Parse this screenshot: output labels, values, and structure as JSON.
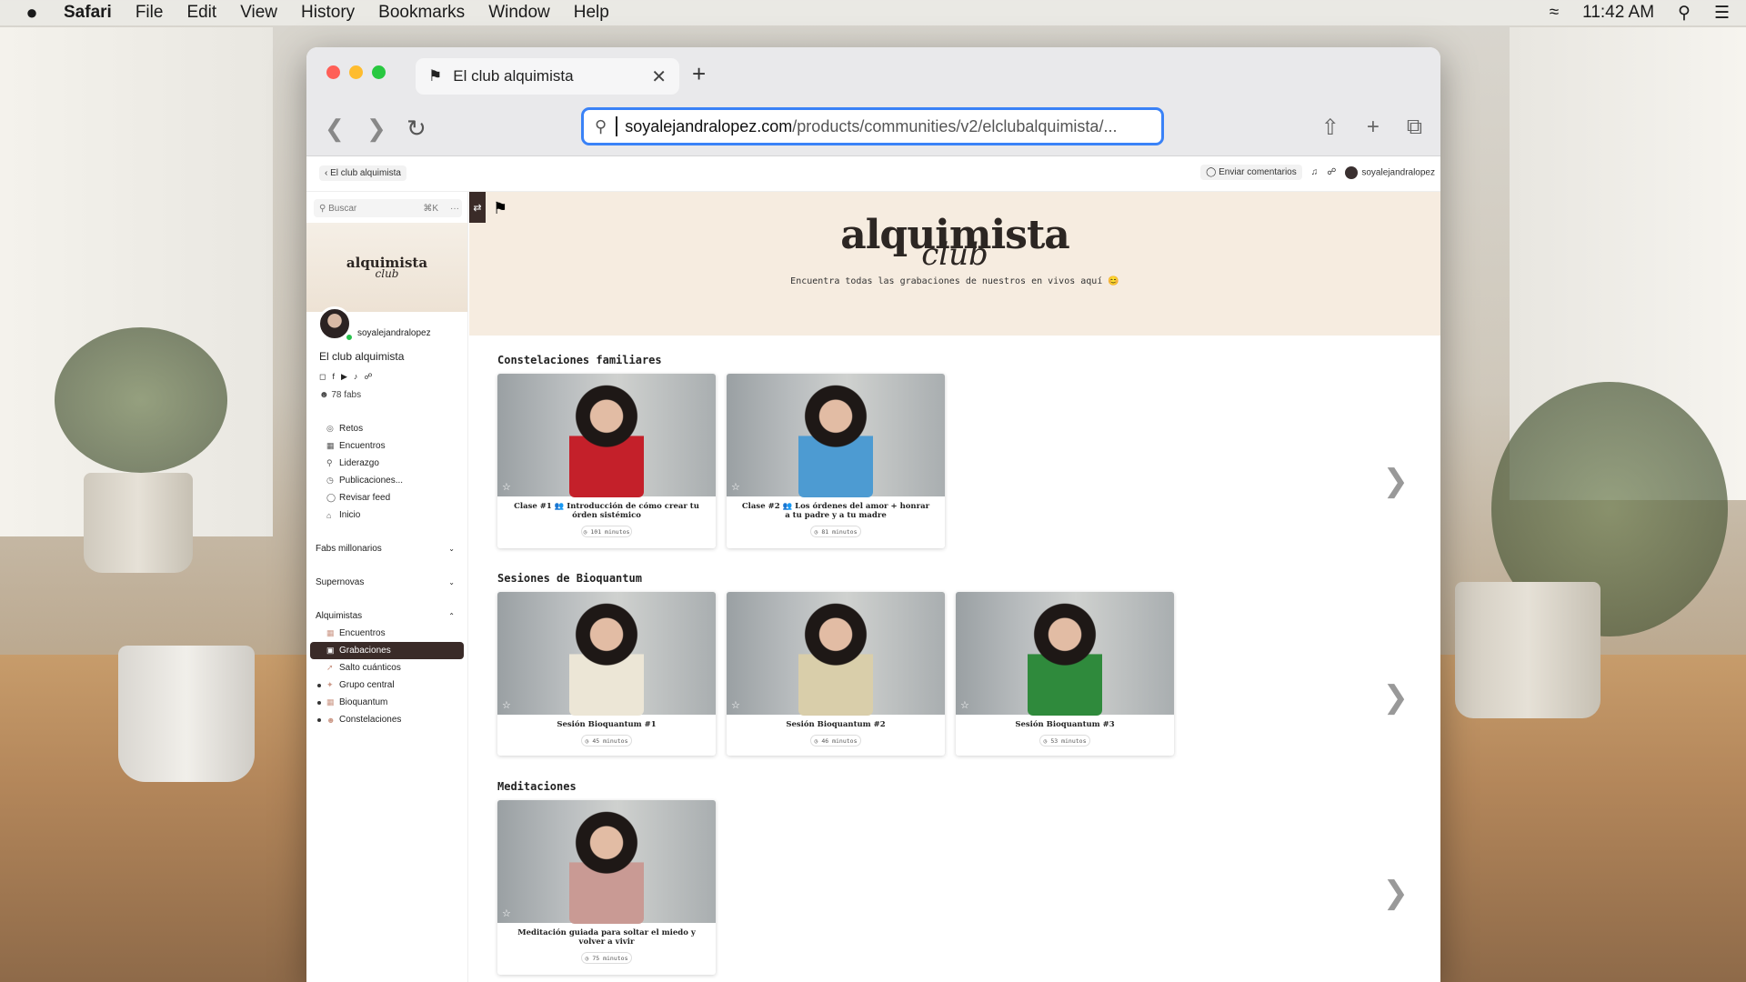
{
  "menubar": {
    "apple": "",
    "items": [
      "Safari",
      "File",
      "Edit",
      "View",
      "History",
      "Bookmarks",
      "Window",
      "Help"
    ],
    "time": "11:42 AM"
  },
  "browser": {
    "tab_title": "El club alquimista",
    "url_domain": "soyalejandralopez.com",
    "url_path": "/products/communities/v2/elclubalquimista/..."
  },
  "topbar": {
    "back_label": "El club alquimista",
    "feedback_label": "Enviar comentarios",
    "username": "soyalejandralopez"
  },
  "sidebar": {
    "search_placeholder": "Buscar",
    "shortcut": "⌘K",
    "more": "···",
    "banner_title": "alquimista",
    "banner_sub": "club",
    "profile_name": "soyalejandralopez",
    "community_name": "El club alquimista",
    "members": "78 fabs",
    "nav": [
      "Retos",
      "Encuentros",
      "Liderazgo",
      "Publicaciones...",
      "Revisar feed",
      "Inicio"
    ],
    "groups": [
      "Fabs millonarios",
      "Supernovas"
    ],
    "open_group": "Alquimistas",
    "open_group_items": [
      "Encuentros",
      "Grabaciones",
      "Salto cuánticos",
      "Grupo central",
      "Bioquantum",
      "Constelaciones"
    ]
  },
  "hero": {
    "title": "alquimista",
    "sub": "club",
    "desc": "Encuentra todas las grabaciones de nuestros en vivos aquí 😊"
  },
  "sections": [
    {
      "title": "Constelaciones familiares",
      "cards": [
        {
          "title": "Clase #1 👥 Introducción de cómo crear tu órden sistémico",
          "duration": "101 minutos",
          "shirt": "#c4202a"
        },
        {
          "title": "Clase #2 👥 Los órdenes del amor + honrar a tu padre y a tu madre",
          "duration": "81 minutos",
          "shirt": "#4d9bd2"
        }
      ]
    },
    {
      "title": "Sesiones de Bioquantum",
      "cards": [
        {
          "title": "Sesión Bioquantum #1",
          "duration": "45 minutos",
          "shirt": "#ece6d6"
        },
        {
          "title": "Sesión Bioquantum #2",
          "duration": "46 minutos",
          "shirt": "#d9ceaa"
        },
        {
          "title": "Sesión Bioquantum #3",
          "duration": "53 minutos",
          "shirt": "#2f8a3c"
        }
      ]
    },
    {
      "title": "Meditaciones",
      "cards": [
        {
          "title": "Meditación guiada para soltar el miedo y volver a vivir",
          "duration": "75 minutos",
          "shirt": "#c99a94"
        }
      ]
    }
  ]
}
